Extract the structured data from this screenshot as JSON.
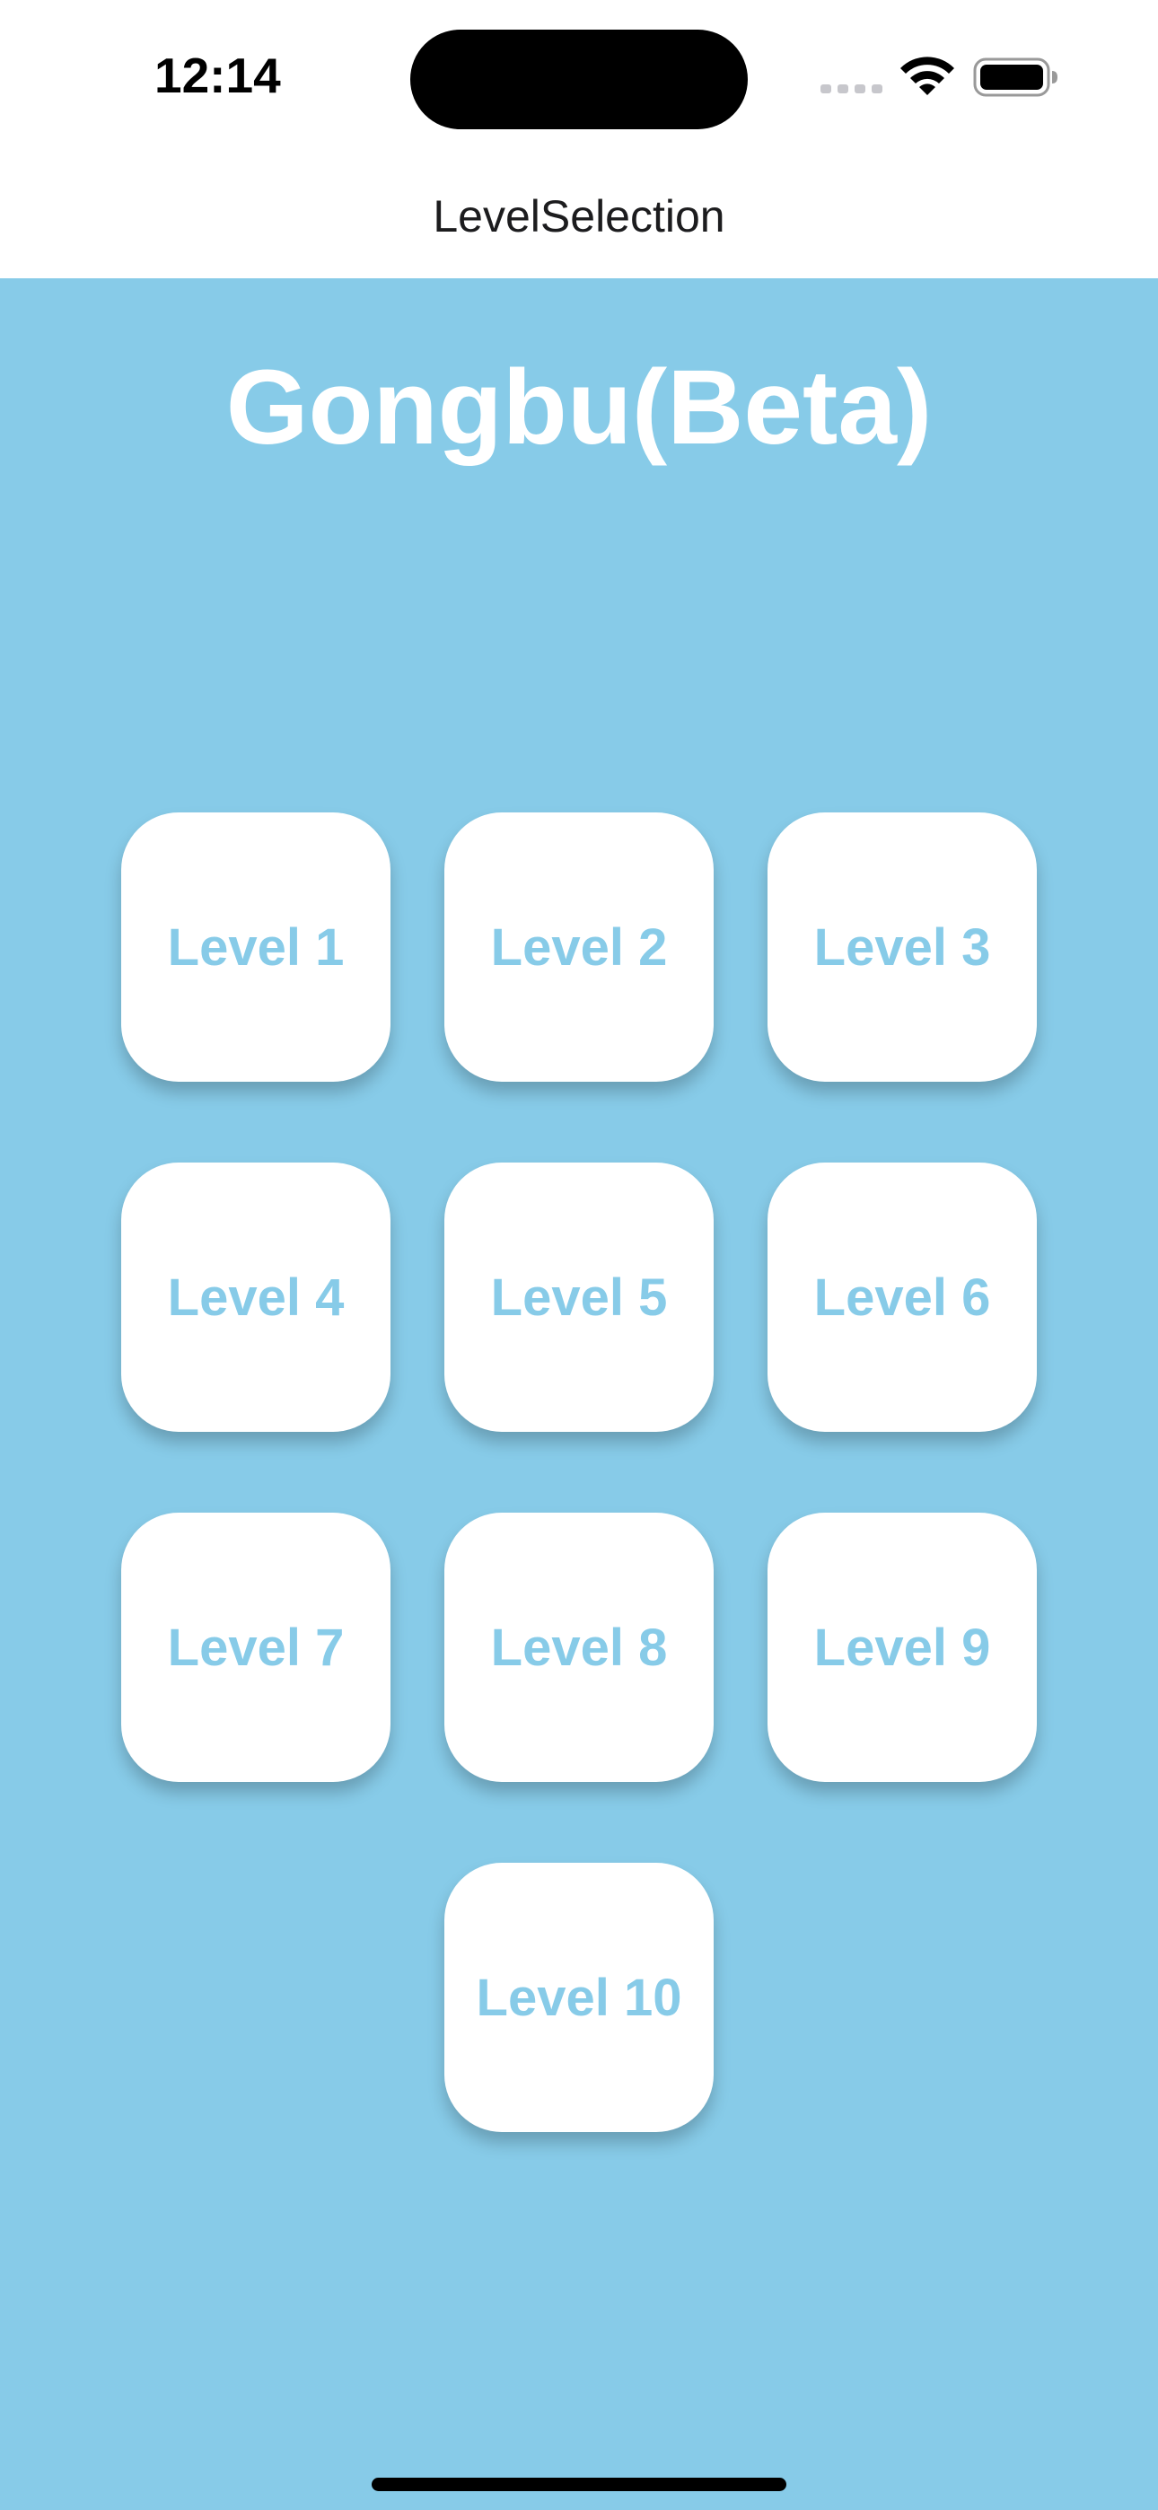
{
  "status": {
    "time": "12:14"
  },
  "nav": {
    "title": "LevelSelection"
  },
  "main": {
    "title": "Gongbu(Beta)",
    "levels": [
      {
        "label": "Level 1"
      },
      {
        "label": "Level 2"
      },
      {
        "label": "Level 3"
      },
      {
        "label": "Level 4"
      },
      {
        "label": "Level 5"
      },
      {
        "label": "Level 6"
      },
      {
        "label": "Level 7"
      },
      {
        "label": "Level 8"
      },
      {
        "label": "Level 9"
      },
      {
        "label": "Level 10"
      }
    ]
  },
  "colors": {
    "background": "#87CBE8",
    "button_background": "#ffffff",
    "button_text": "#87CBE8",
    "title_text": "#ffffff"
  },
  "icons": {
    "signal": "cellular-signal-icon",
    "wifi": "wifi-icon",
    "battery": "battery-icon"
  }
}
